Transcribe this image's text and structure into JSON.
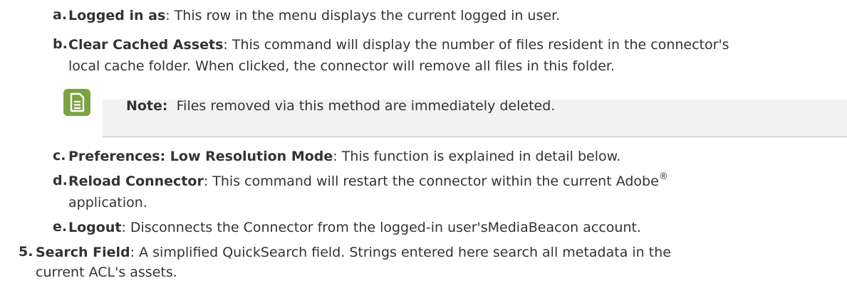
{
  "items": {
    "a": {
      "marker": "a.",
      "term": "Logged in as",
      "text": ": This row in the menu displays the current logged in user."
    },
    "b": {
      "marker": "b.",
      "term": "Clear Cached Assets",
      "text": ": This command will display the number of files resident in the connector's",
      "cont": "local cache folder. When clicked, the connector will remove all files in this folder."
    },
    "c": {
      "marker": "c.",
      "term": "Preferences: Low Resolution Mode",
      "text": ": This function is explained in detail below."
    },
    "d": {
      "marker": "d.",
      "term": "Reload Connector",
      "text": ": This command will restart the connector within the current Adobe",
      "sup": "®",
      "cont": "application."
    },
    "e": {
      "marker": "e.",
      "term": "Logout",
      "text": ": Disconnects the Connector from the logged-in user'sMediaBeacon account."
    },
    "five": {
      "marker": "5.",
      "term": "Search Field",
      "text": ": A simplified QuickSearch field. Strings entered here search all metadata in the",
      "cont": "current ACL's assets."
    }
  },
  "note": {
    "label": "Note:",
    "text": "Files removed via this method are immediately deleted.",
    "icon": "note-document-icon",
    "icon_color": "#7ca242"
  }
}
